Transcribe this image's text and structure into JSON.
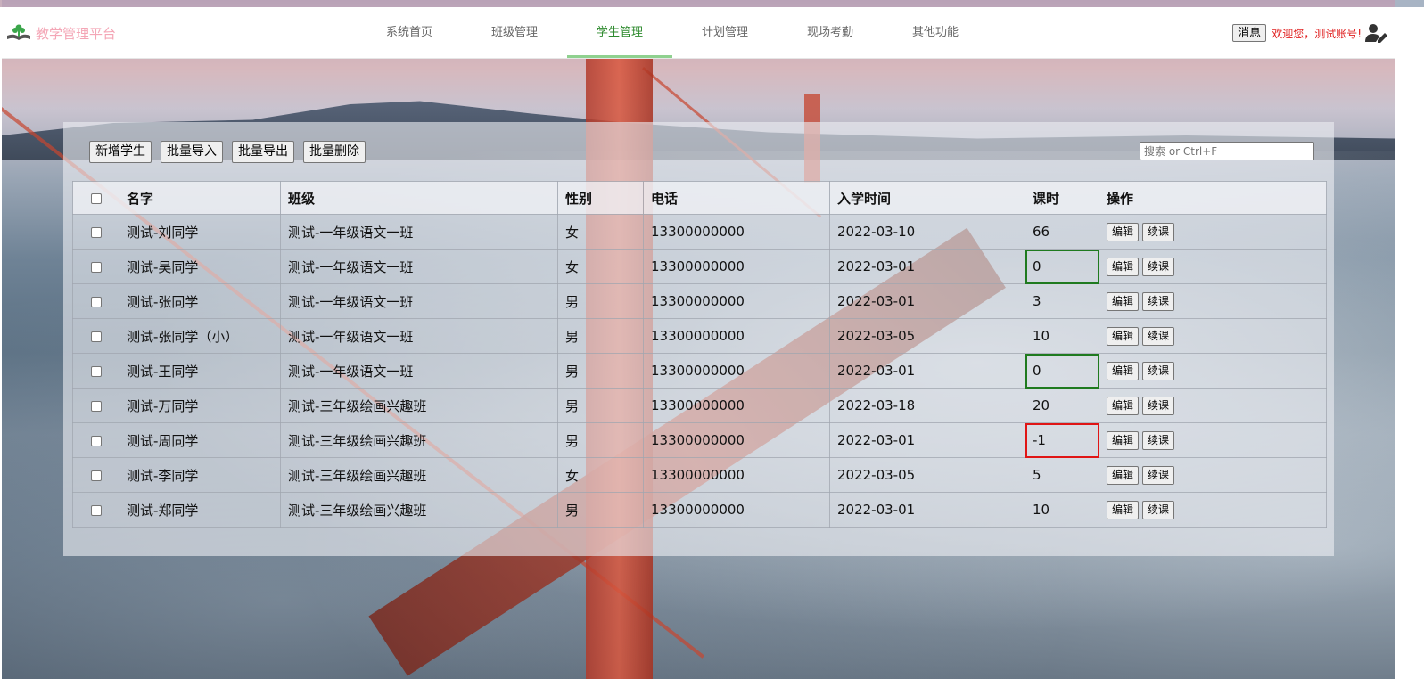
{
  "app": {
    "title": "教学管理平台"
  },
  "nav": {
    "items": [
      {
        "label": "系统首页",
        "active": false
      },
      {
        "label": "班级管理",
        "active": false
      },
      {
        "label": "学生管理",
        "active": true
      },
      {
        "label": "计划管理",
        "active": false
      },
      {
        "label": "现场考勤",
        "active": false
      },
      {
        "label": "其他功能",
        "active": false
      }
    ]
  },
  "user": {
    "message_label": "消息",
    "welcome": "欢迎您，测试账号!"
  },
  "toolbar": {
    "add_label": "新增学生",
    "import_label": "批量导入",
    "export_label": "批量导出",
    "delete_label": "批量删除"
  },
  "search": {
    "placeholder": "搜索 or Ctrl+F"
  },
  "table": {
    "headers": [
      "名字",
      "班级",
      "性别",
      "电话",
      "入学时间",
      "课时",
      "操作"
    ],
    "edit_label": "编辑",
    "renew_label": "续课",
    "rows": [
      {
        "name": "测试-刘同学",
        "class": "测试-一年级语文一班",
        "gender": "女",
        "phone": "13300000000",
        "date": "2022-03-10",
        "hours": "66",
        "status": "normal"
      },
      {
        "name": "测试-吴同学",
        "class": "测试-一年级语文一班",
        "gender": "女",
        "phone": "13300000000",
        "date": "2022-03-01",
        "hours": "0",
        "status": "green"
      },
      {
        "name": "测试-张同学",
        "class": "测试-一年级语文一班",
        "gender": "男",
        "phone": "13300000000",
        "date": "2022-03-01",
        "hours": "3",
        "status": "normal"
      },
      {
        "name": "测试-张同学（小）",
        "class": "测试-一年级语文一班",
        "gender": "男",
        "phone": "13300000000",
        "date": "2022-03-05",
        "hours": "10",
        "status": "normal"
      },
      {
        "name": "测试-王同学",
        "class": "测试-一年级语文一班",
        "gender": "男",
        "phone": "13300000000",
        "date": "2022-03-01",
        "hours": "0",
        "status": "green"
      },
      {
        "name": "测试-万同学",
        "class": "测试-三年级绘画兴趣班",
        "gender": "男",
        "phone": "13300000000",
        "date": "2022-03-18",
        "hours": "20",
        "status": "normal"
      },
      {
        "name": "测试-周同学",
        "class": "测试-三年级绘画兴趣班",
        "gender": "男",
        "phone": "13300000000",
        "date": "2022-03-01",
        "hours": "-1",
        "status": "red"
      },
      {
        "name": "测试-李同学",
        "class": "测试-三年级绘画兴趣班",
        "gender": "女",
        "phone": "13300000000",
        "date": "2022-03-05",
        "hours": "5",
        "status": "normal"
      },
      {
        "name": "测试-郑同学",
        "class": "测试-三年级绘画兴趣班",
        "gender": "男",
        "phone": "13300000000",
        "date": "2022-03-01",
        "hours": "10",
        "status": "normal"
      }
    ]
  },
  "colors": {
    "brand_text": "#f4a6b6",
    "nav_active": "#2d8a2d",
    "welcome": "#e02020",
    "hours_zero_border": "#1f7a1f",
    "hours_negative_border": "#e01515"
  },
  "icons": {
    "logo": "book-plant-icon",
    "user": "user-edit-icon"
  }
}
